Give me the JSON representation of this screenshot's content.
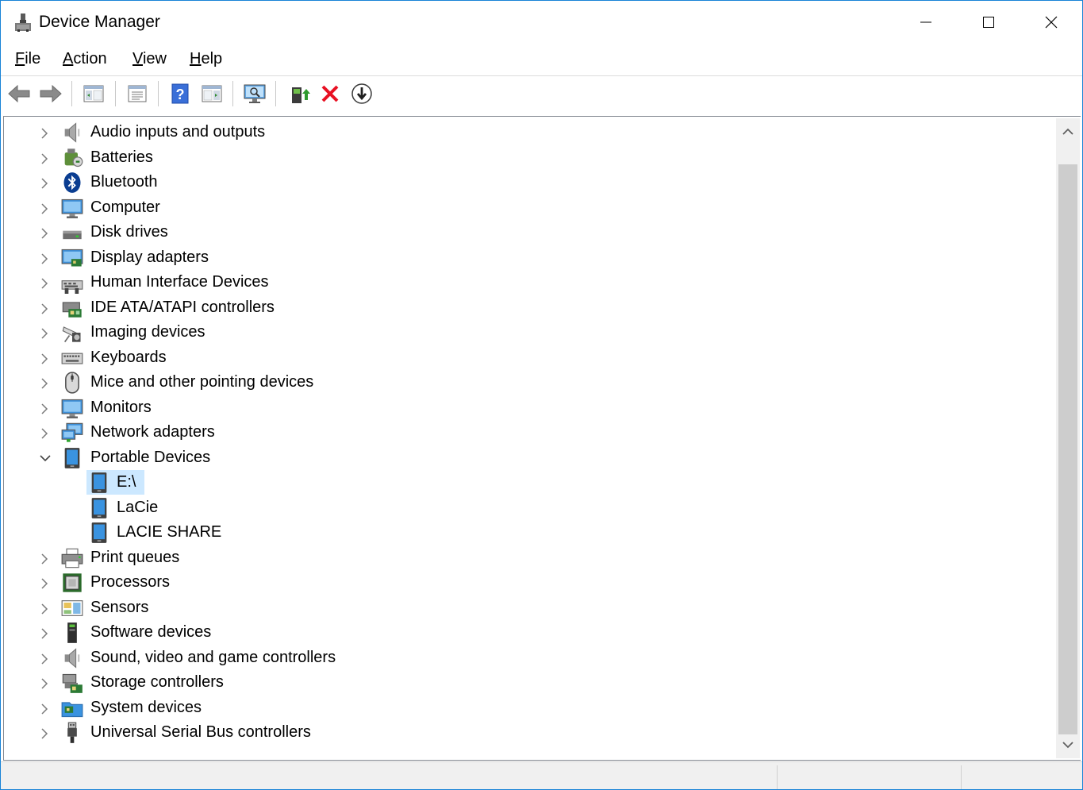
{
  "window": {
    "title": "Device Manager"
  },
  "menu": [
    {
      "label": "File",
      "accel": "F",
      "rest": "ile"
    },
    {
      "label": "Action",
      "accel": "A",
      "rest": "ction"
    },
    {
      "label": "View",
      "accel": "V",
      "rest": "iew"
    },
    {
      "label": "Help",
      "accel": "H",
      "rest": "elp"
    }
  ],
  "toolbar": [
    "back-icon",
    "forward-icon",
    "show-hide-console-tree-icon",
    "properties-icon",
    "help-icon",
    "action-pane-icon",
    "scan-hardware-icon",
    "update-driver-icon",
    "uninstall-device-icon",
    "disable-device-icon"
  ],
  "tree": {
    "items": [
      {
        "label": "Audio inputs and outputs",
        "icon": "speaker-icon",
        "expanded": false
      },
      {
        "label": "Batteries",
        "icon": "battery-icon",
        "expanded": false
      },
      {
        "label": "Bluetooth",
        "icon": "bluetooth-icon",
        "expanded": false
      },
      {
        "label": "Computer",
        "icon": "computer-icon",
        "expanded": false
      },
      {
        "label": "Disk drives",
        "icon": "disk-drive-icon",
        "expanded": false
      },
      {
        "label": "Display adapters",
        "icon": "display-adapter-icon",
        "expanded": false
      },
      {
        "label": "Human Interface Devices",
        "icon": "hid-icon",
        "expanded": false
      },
      {
        "label": "IDE ATA/ATAPI controllers",
        "icon": "ide-controller-icon",
        "expanded": false
      },
      {
        "label": "Imaging devices",
        "icon": "camera-icon",
        "expanded": false
      },
      {
        "label": "Keyboards",
        "icon": "keyboard-icon",
        "expanded": false
      },
      {
        "label": "Mice and other pointing devices",
        "icon": "mouse-icon",
        "expanded": false
      },
      {
        "label": "Monitors",
        "icon": "monitor-icon",
        "expanded": false
      },
      {
        "label": "Network adapters",
        "icon": "network-adapter-icon",
        "expanded": false
      },
      {
        "label": "Portable Devices",
        "icon": "portable-device-icon",
        "expanded": true,
        "children": [
          {
            "label": "E:\\",
            "icon": "portable-device-icon",
            "selected": true
          },
          {
            "label": "LaCie",
            "icon": "portable-device-icon"
          },
          {
            "label": "LACIE SHARE",
            "icon": "portable-device-icon"
          }
        ]
      },
      {
        "label": "Print queues",
        "icon": "printer-icon",
        "expanded": false
      },
      {
        "label": "Processors",
        "icon": "processor-icon",
        "expanded": false
      },
      {
        "label": "Sensors",
        "icon": "sensor-icon",
        "expanded": false
      },
      {
        "label": "Software devices",
        "icon": "software-device-icon",
        "expanded": false
      },
      {
        "label": "Sound, video and game controllers",
        "icon": "speaker-icon",
        "expanded": false
      },
      {
        "label": "Storage controllers",
        "icon": "storage-controller-icon",
        "expanded": false
      },
      {
        "label": "System devices",
        "icon": "system-folder-icon",
        "expanded": false
      },
      {
        "label": "Universal Serial Bus controllers",
        "icon": "usb-icon",
        "expanded": false
      }
    ]
  },
  "colors": {
    "selection": "#cce8ff",
    "window_border": "#1883d7",
    "accent_blue": "#2d7fd6",
    "uninstall_red": "#e81123"
  }
}
